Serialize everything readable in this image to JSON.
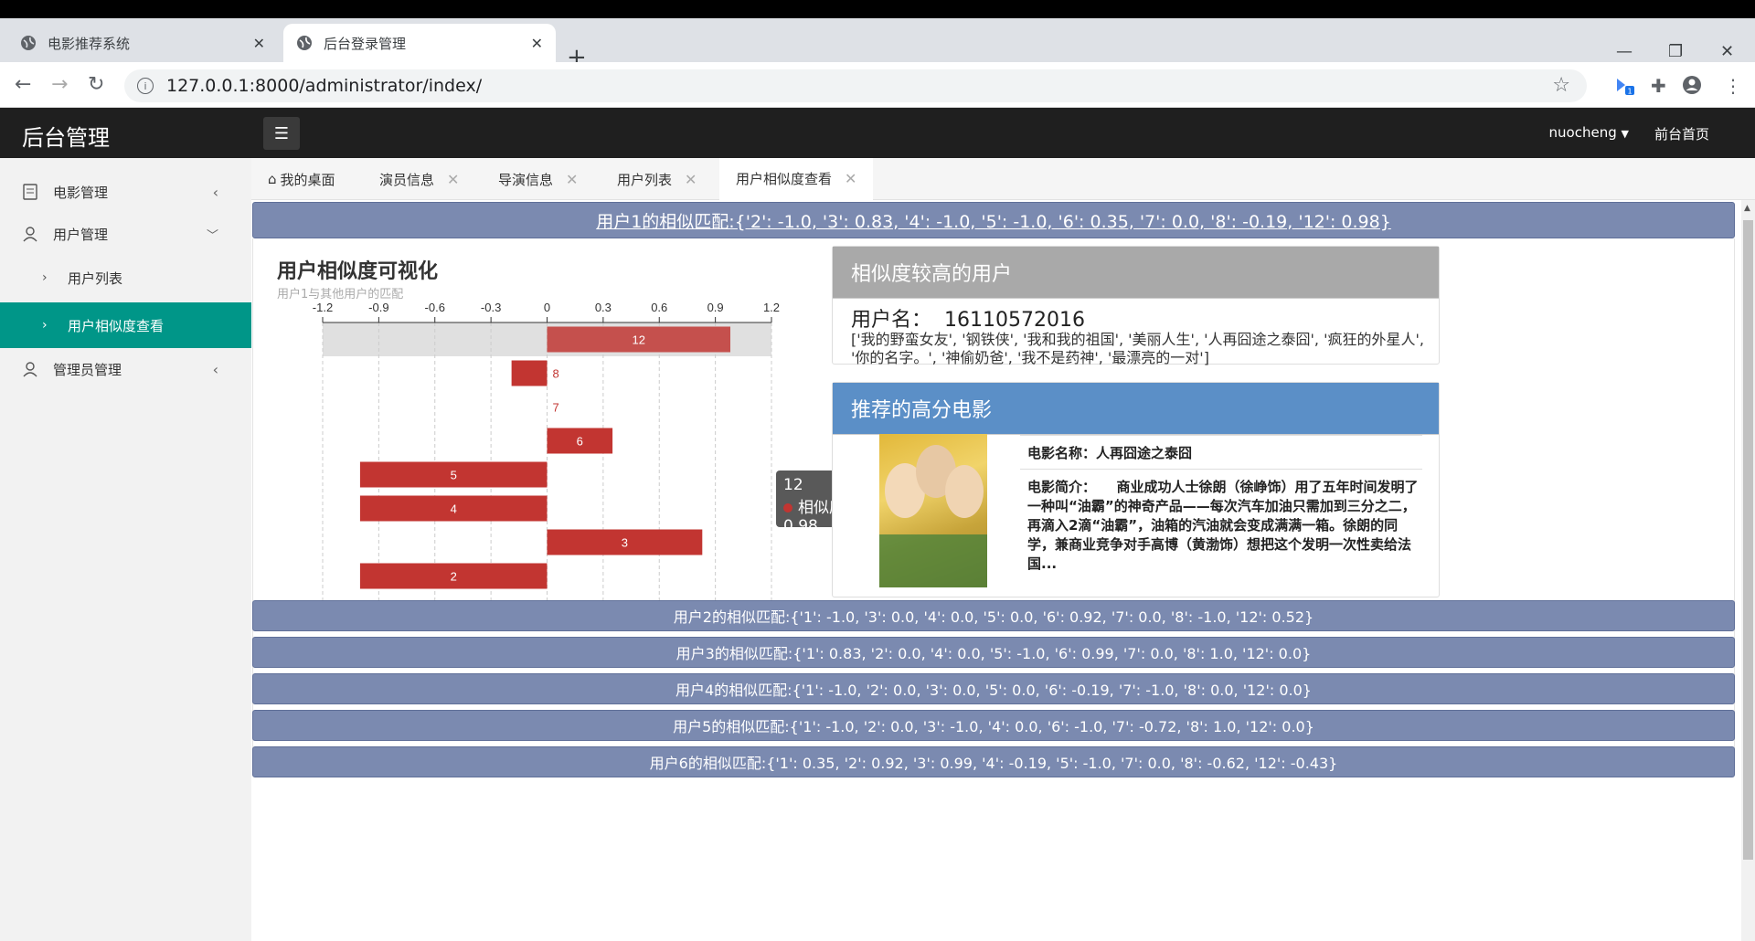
{
  "browser": {
    "tabs": [
      {
        "title": "电影推荐系统",
        "active": false
      },
      {
        "title": "后台登录管理",
        "active": true
      }
    ],
    "url": "127.0.0.1:8000/administrator/index/",
    "extension_badge": "1"
  },
  "header": {
    "title": "后台管理",
    "username": "nuocheng",
    "front_home": "前台首页"
  },
  "sidebar": {
    "items": [
      {
        "label": "电影管理",
        "icon": "document-icon",
        "expanded": false
      },
      {
        "label": "用户管理",
        "icon": "user-icon",
        "expanded": true
      },
      {
        "label": "用户列表",
        "sub": true
      },
      {
        "label": "用户相似度查看",
        "sub": true,
        "active": true
      },
      {
        "label": "管理员管理",
        "icon": "user-icon",
        "expanded": false
      }
    ]
  },
  "content_tabs": [
    {
      "label": "我的桌面",
      "icon": "home-icon",
      "closable": false
    },
    {
      "label": "演员信息",
      "closable": true
    },
    {
      "label": "导演信息",
      "closable": true
    },
    {
      "label": "用户列表",
      "closable": true
    },
    {
      "label": "用户相似度查看",
      "closable": true,
      "active": true
    }
  ],
  "similarity_rows": [
    "用户1的相似匹配:{'2': -1.0, '3': 0.83, '4': -1.0, '5': -1.0, '6': 0.35, '7': 0.0, '8': -0.19, '12': 0.98}",
    "用户2的相似匹配:{'1': -1.0, '3': 0.0, '4': 0.0, '5': 0.0, '6': 0.92, '7': 0.0, '8': -1.0, '12': 0.52}",
    "用户3的相似匹配:{'1': 0.83, '2': 0.0, '4': 0.0, '5': -1.0, '6': 0.99, '7': 0.0, '8': 1.0, '12': 0.0}",
    "用户4的相似匹配:{'1': -1.0, '2': 0.0, '3': 0.0, '5': 0.0, '6': -0.19, '7': -1.0, '8': 0.0, '12': 0.0}",
    "用户5的相似匹配:{'1': -1.0, '2': 0.0, '3': -1.0, '4': 0.0, '6': -1.0, '7': -0.72, '8': 1.0, '12': 0.0}",
    "用户6的相似匹配:{'1': 0.35, '2': 0.92, '3': 0.99, '4': -0.19, '5': -1.0, '7': 0.0, '8': -0.62, '12': -0.43}"
  ],
  "chart_panel": {
    "title": "用户相似度可视化",
    "subtitle": "用户1与其他用户的匹配"
  },
  "chart_data": {
    "type": "bar",
    "orientation": "horizontal",
    "categories": [
      "12",
      "8",
      "7",
      "6",
      "5",
      "4",
      "3",
      "2"
    ],
    "series": [
      {
        "name": "相似度",
        "values": [
          0.98,
          -0.19,
          0.0,
          0.35,
          -1.0,
          -1.0,
          0.83,
          -1.0
        ]
      }
    ],
    "xlim": [
      -1.2,
      1.2
    ],
    "xticks": [
      "-1.2",
      "-0.9",
      "-0.6",
      "-0.3",
      "0",
      "0.3",
      "0.6",
      "0.9",
      "1.2"
    ],
    "grid": true,
    "highlighted_category": "12",
    "bar_color": "#c23531",
    "tooltip": {
      "title": "12",
      "label": "相似度: 0.98"
    }
  },
  "similar_user_card": {
    "title": "相似度较高的用户",
    "username_label": "用户名：",
    "username": "16110572016",
    "movies": "['我的野蛮女友', '钢铁侠', '我和我的祖国', '美丽人生', '人再囧途之泰囧', '疯狂的外星人', '你的名字。', '神偷奶爸', '我不是药神', '最漂亮的一对']"
  },
  "recommend_card": {
    "title": "推荐的高分电影",
    "movie_name": "电影名称：人再囧途之泰囧",
    "movie_desc": "电影简介：　　商业成功人士徐朗（徐峥饰）用了五年时间发明了一种叫“油霸”的神奇产品——每次汽车加油只需加到三分之二，再滴入2滴“油霸”，油箱的汽油就会变成满满一箱。徐朗的同学，兼商业竞争对手高博（黄渤饰）想把这个发明一次性卖给法国..."
  },
  "colors": {
    "accent": "#009688",
    "header_bg": "#1f1f1f",
    "row_bg": "#7b8ab0",
    "similar_head": "#a9a9a9",
    "recommend_head": "#5b8fc7"
  }
}
